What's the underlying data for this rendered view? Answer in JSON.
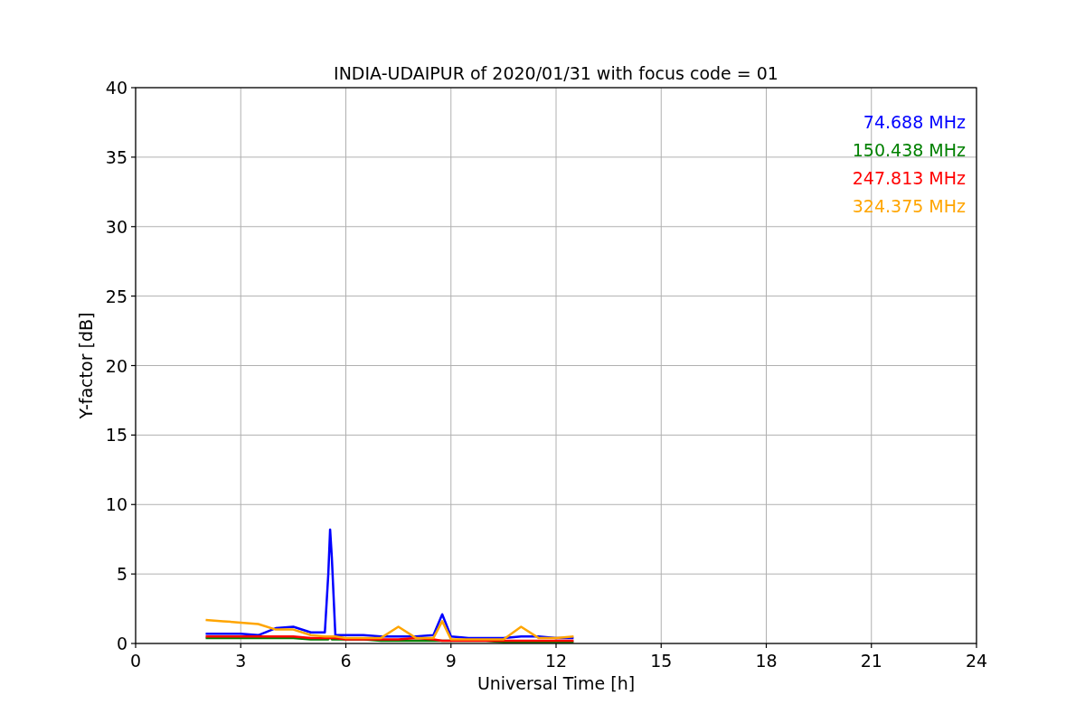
{
  "chart_data": {
    "type": "line",
    "title": "INDIA-UDAIPUR of 2020/01/31 with focus code = 01",
    "xlabel": "Universal Time [h]",
    "ylabel": "Y-factor [dB]",
    "x": [
      2,
      2.5,
      3,
      3.5,
      4,
      4.5,
      5,
      5.4,
      5.5,
      5.55,
      5.6,
      5.7,
      6,
      6.5,
      7,
      7.5,
      8,
      8.5,
      8.75,
      9,
      9.5,
      10,
      10.5,
      11,
      11.5,
      12,
      12.5
    ],
    "series": [
      {
        "name": "74.688 MHz",
        "color": "#0000ff",
        "values": [
          0.7,
          0.7,
          0.7,
          0.6,
          1.1,
          1.2,
          0.8,
          0.8,
          5,
          8.2,
          6.2,
          0.6,
          0.6,
          0.6,
          0.5,
          0.5,
          0.5,
          0.6,
          2.1,
          0.5,
          0.4,
          0.4,
          0.4,
          0.5,
          0.5,
          0.4,
          0.4
        ]
      },
      {
        "name": "150.438 MHz",
        "color": "#008000",
        "values": [
          0.4,
          0.4,
          0.4,
          0.4,
          0.4,
          0.4,
          0.3,
          0.3,
          0.3,
          0.5,
          0.3,
          0.3,
          0.3,
          0.3,
          0.2,
          0.2,
          0.2,
          0.2,
          0.2,
          0.2,
          0.2,
          0.2,
          0.1,
          0.1,
          0.1,
          0.1,
          0.1
        ]
      },
      {
        "name": "247.813 MHz",
        "color": "#ff0000",
        "values": [
          0.5,
          0.5,
          0.5,
          0.5,
          0.5,
          0.5,
          0.4,
          0.4,
          0.4,
          0.4,
          0.4,
          0.4,
          0.3,
          0.3,
          0.3,
          0.3,
          0.4,
          0.3,
          0.2,
          0.2,
          0.2,
          0.2,
          0.2,
          0.2,
          0.2,
          0.2,
          0.2
        ]
      },
      {
        "name": "324.375 MHz",
        "color": "#ffa500",
        "values": [
          1.7,
          1.6,
          1.5,
          1.4,
          1.0,
          1.0,
          0.6,
          0.5,
          0.5,
          0.5,
          0.5,
          0.5,
          0.4,
          0.4,
          0.4,
          1.2,
          0.4,
          0.4,
          1.6,
          0.3,
          0.3,
          0.3,
          0.3,
          1.2,
          0.4,
          0.4,
          0.5
        ]
      }
    ],
    "xlim": [
      0,
      24
    ],
    "ylim": [
      0,
      40
    ],
    "xticks": [
      0,
      3,
      6,
      9,
      12,
      15,
      18,
      21,
      24
    ],
    "yticks": [
      0,
      5,
      10,
      15,
      20,
      25,
      30,
      35,
      40
    ],
    "grid": true
  }
}
